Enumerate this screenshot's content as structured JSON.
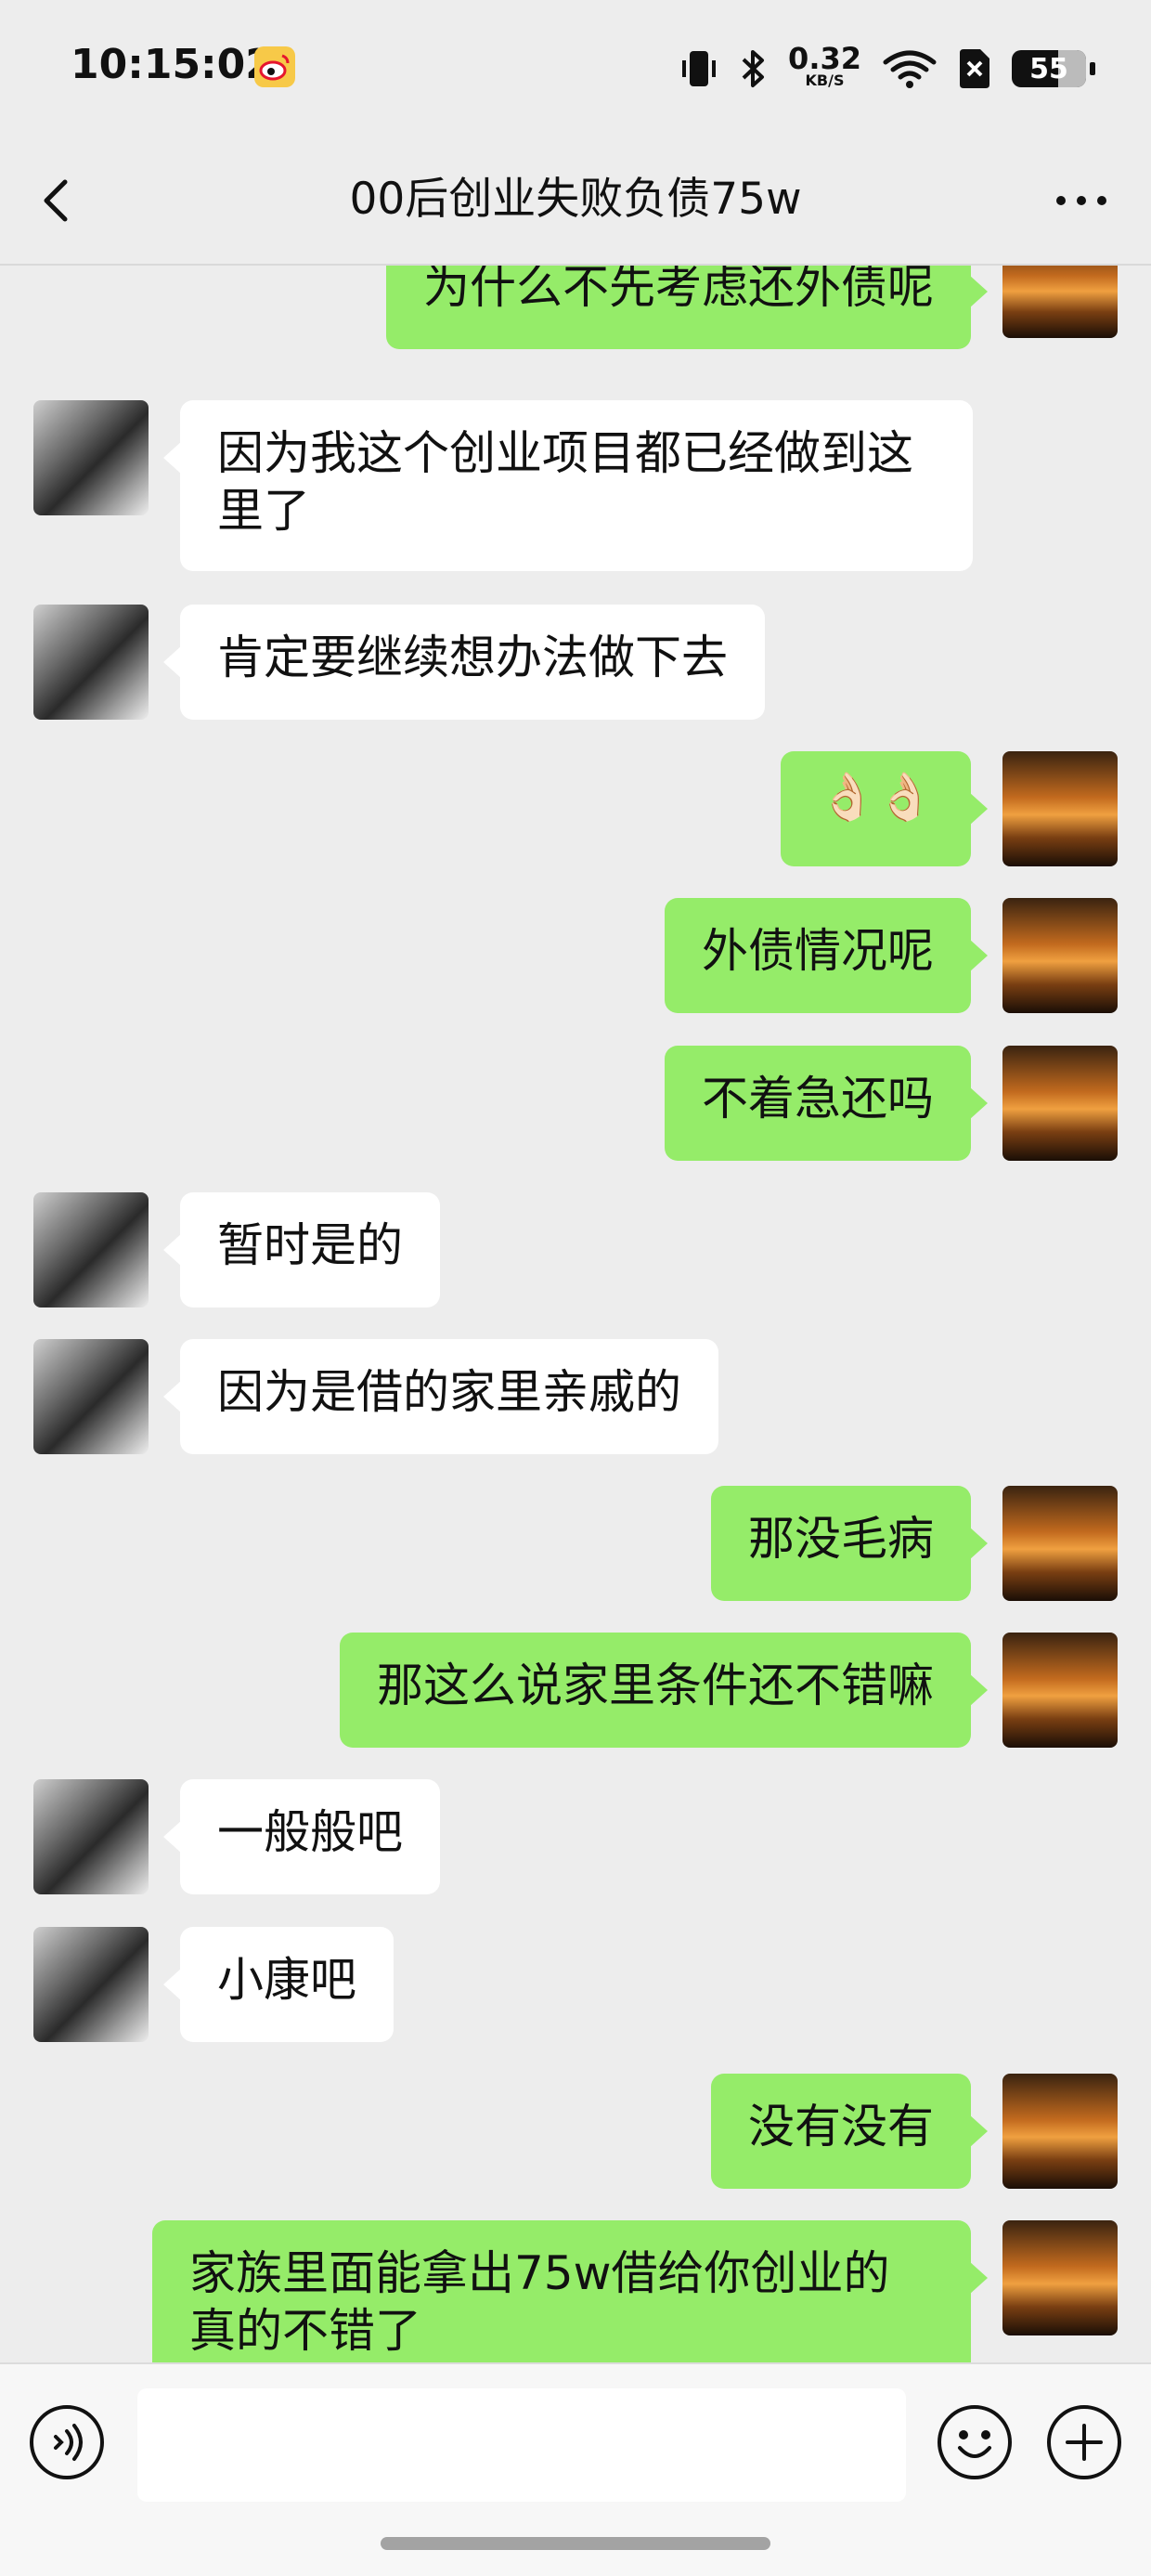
{
  "status_bar": {
    "time": "10:15:02",
    "net_speed_value": "0.32",
    "net_speed_unit": "KB/S",
    "battery": "55"
  },
  "header": {
    "title": "00后创业失败负债75w"
  },
  "messages": [
    {
      "side": "right",
      "text": "为什么不先考虑还外债呢"
    },
    {
      "side": "left",
      "text": "因为我这个创业项目都已经做到这里了"
    },
    {
      "side": "left",
      "text": "肯定要继续想办法做下去"
    },
    {
      "side": "right",
      "text": "👌🏻👌🏻"
    },
    {
      "side": "right",
      "text": "外债情况呢"
    },
    {
      "side": "right",
      "text": "不着急还吗"
    },
    {
      "side": "left",
      "text": "暂时是的"
    },
    {
      "side": "left",
      "text": "因为是借的家里亲戚的"
    },
    {
      "side": "right",
      "text": "那没毛病"
    },
    {
      "side": "right",
      "text": "那这么说家里条件还不错嘛"
    },
    {
      "side": "left",
      "text": "一般般吧"
    },
    {
      "side": "left",
      "text": "小康吧"
    },
    {
      "side": "right",
      "text": "没有没有"
    },
    {
      "side": "right",
      "text": "家族里面能拿出75w借给你创业的真的不错了"
    }
  ],
  "input_bar": {
    "value": "",
    "placeholder": ""
  },
  "colors": {
    "background": "#ededed",
    "sent_bubble": "#95ec69",
    "received_bubble": "#ffffff"
  },
  "icons": {
    "back": "chevron-left-icon",
    "more": "more-horizontal-icon",
    "voice": "voice-icon",
    "emoji": "emoji-icon",
    "plus": "plus-icon"
  }
}
